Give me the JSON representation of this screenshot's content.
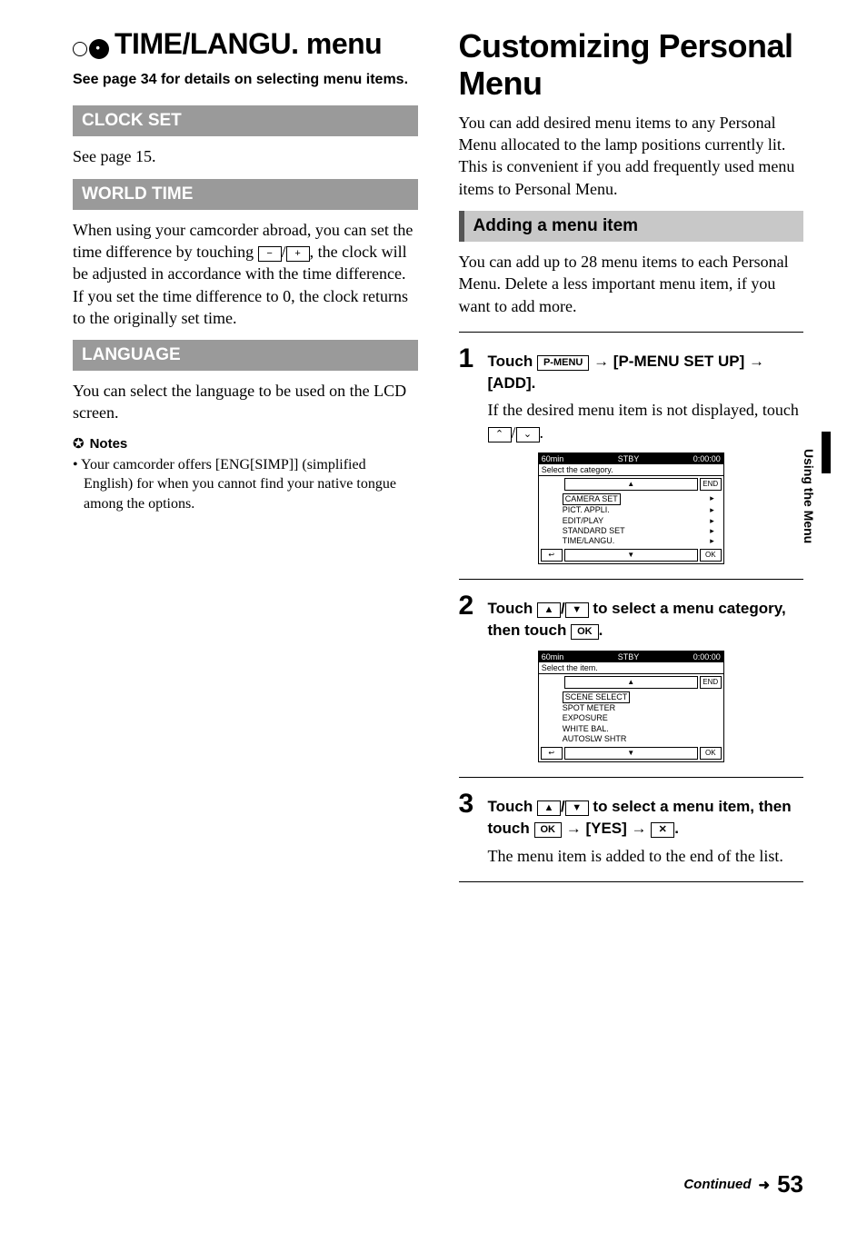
{
  "left": {
    "title_top": "TIME/LANGU. menu",
    "intro": "See page 34 for details on selecting menu items.",
    "clock_set": {
      "heading": "CLOCK SET",
      "body": "See page 15."
    },
    "world_time": {
      "heading": "WORLD TIME",
      "body1a": "When using your camcorder abroad, you can set the time difference by touching ",
      "key_minus": "−",
      "key_plus": "+",
      "body1b": ", the clock will be adjusted in accordance with the time difference.",
      "body2": "If you set the time difference to 0, the clock returns to the originally set time."
    },
    "language": {
      "heading": "LANGUAGE",
      "body": "You can select the language to be used on the LCD screen.",
      "notes_head": "Notes",
      "note1": "Your camcorder offers [ENG[SIMP]] (simplified English) for when you cannot find your native tongue among the options."
    }
  },
  "right": {
    "title": "Customizing Personal Menu",
    "intro": "You can add desired menu items to any Personal Menu allocated to the lamp positions currently lit. This is convenient if you add frequently used menu items to Personal Menu.",
    "sub": "Adding a menu item",
    "sub_intro": "You can add up to 28 menu items to each Personal Menu. Delete a less important menu item, if you want to add more.",
    "step1": {
      "n": "1",
      "pre": "Touch ",
      "pmenu": "P-MENU",
      "mid": " → [P-MENU SET UP] → [ADD].",
      "follow_a": "If the desired menu item is not displayed, touch ",
      "follow_b": "."
    },
    "step2": {
      "n": "2",
      "pre": "Touch ",
      "mid": " to select a menu category, then touch ",
      "ok": "OK",
      "end": "."
    },
    "step3": {
      "n": "3",
      "pre": "Touch ",
      "mid": " to select a menu item, then touch ",
      "ok": "OK",
      "mid2": " → [YES] → ",
      "x": "✕",
      "end": ".",
      "follow": "The menu item is added to the end of the list."
    },
    "keys": {
      "up_caret": "▲",
      "down_caret": "▼",
      "page_up": "⌃",
      "page_down": "⌄"
    }
  },
  "screen1": {
    "battery": "60min",
    "status": "STBY",
    "time": "0:00:00",
    "title": "Select the category.",
    "items": [
      "CAMERA SET",
      "PICT. APPLI.",
      "EDIT/PLAY",
      "STANDARD SET",
      "TIME/LANGU."
    ],
    "end": "END",
    "ok": "OK",
    "back": "↩",
    "up": "▲",
    "down": "▼",
    "chev": "▸"
  },
  "screen2": {
    "battery": "60min",
    "status": "STBY",
    "time": "0:00:00",
    "title": "Select the item.",
    "items": [
      "SCENE SELECT",
      "SPOT METER",
      "EXPOSURE",
      "WHITE BAL.",
      "AUTOSLW SHTR"
    ],
    "end": "END",
    "ok": "OK",
    "back": "↩",
    "up": "▲",
    "down": "▼"
  },
  "side_tab": "Using the Menu",
  "footer": {
    "continued": "Continued",
    "arrow": "➜",
    "page": "53"
  }
}
